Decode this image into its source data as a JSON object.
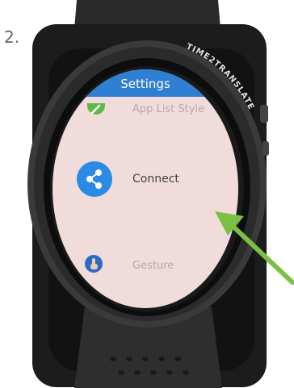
{
  "step_label": "2.",
  "watch": {
    "brand": "TIME2TRANSLATE"
  },
  "screen": {
    "title": "Settings",
    "items": [
      {
        "label": "App List Style",
        "icon": "pencil-icon"
      },
      {
        "label": "Connect",
        "icon": "share-icon"
      },
      {
        "label": "Gesture",
        "icon": "hand-icon"
      }
    ]
  },
  "colors": {
    "title_bar": "#2f7fd3",
    "screen_bg": "#f1dcdc",
    "connect_icon": "#2a8ae4",
    "pencil_icon": "#5fb94a",
    "arrow": "#7ac143"
  }
}
